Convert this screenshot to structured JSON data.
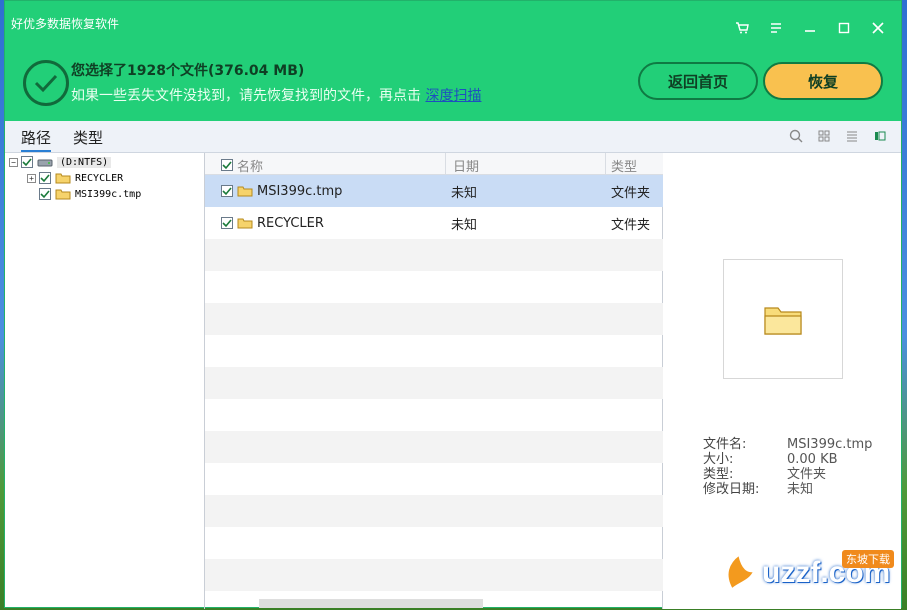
{
  "window": {
    "title": "好优多数据恢复软件",
    "controls": [
      "cart-icon",
      "menu-icon",
      "minimize-icon",
      "maximize-icon",
      "close-icon"
    ]
  },
  "header": {
    "summary": "您选择了1928个文件(376.04 MB)",
    "hint_prefix": "如果一些丢失文件没找到，请先恢复找到的文件，再点击",
    "hint_link": "深度扫描",
    "home_button": "返回首页",
    "recover_button": "恢复"
  },
  "toolbar": {
    "tabs": [
      {
        "label": "路径",
        "active": true
      },
      {
        "label": "类型",
        "active": false
      }
    ],
    "view_icons": [
      "search-icon",
      "grid-view-icon",
      "list-view-icon",
      "detail-view-icon"
    ]
  },
  "tree": {
    "root": "(D:NTFS)",
    "children": [
      "RECYCLER",
      "MSI399c.tmp"
    ]
  },
  "list": {
    "columns": [
      "名称",
      "日期",
      "类型"
    ],
    "rows": [
      {
        "name": "MSI399c.tmp",
        "date": "未知",
        "type": "文件夹",
        "selected": true
      },
      {
        "name": "RECYCLER",
        "date": "未知",
        "type": "文件夹",
        "selected": false
      }
    ]
  },
  "preview": {
    "labels": {
      "filename": "文件名:",
      "size": "大小:",
      "type": "类型:",
      "modified": "修改日期:"
    },
    "values": {
      "filename": "MSI399c.tmp",
      "size": "0.00 KB",
      "type": "文件夹",
      "modified": "未知"
    }
  },
  "watermark": {
    "text": "uzzf.com",
    "badge": "东坡下载"
  },
  "colors": {
    "header_green": "#22cf78",
    "recover_yellow": "#f9c14f",
    "selected_row": "#c9dcf5",
    "link_blue": "#1e4fbf"
  }
}
